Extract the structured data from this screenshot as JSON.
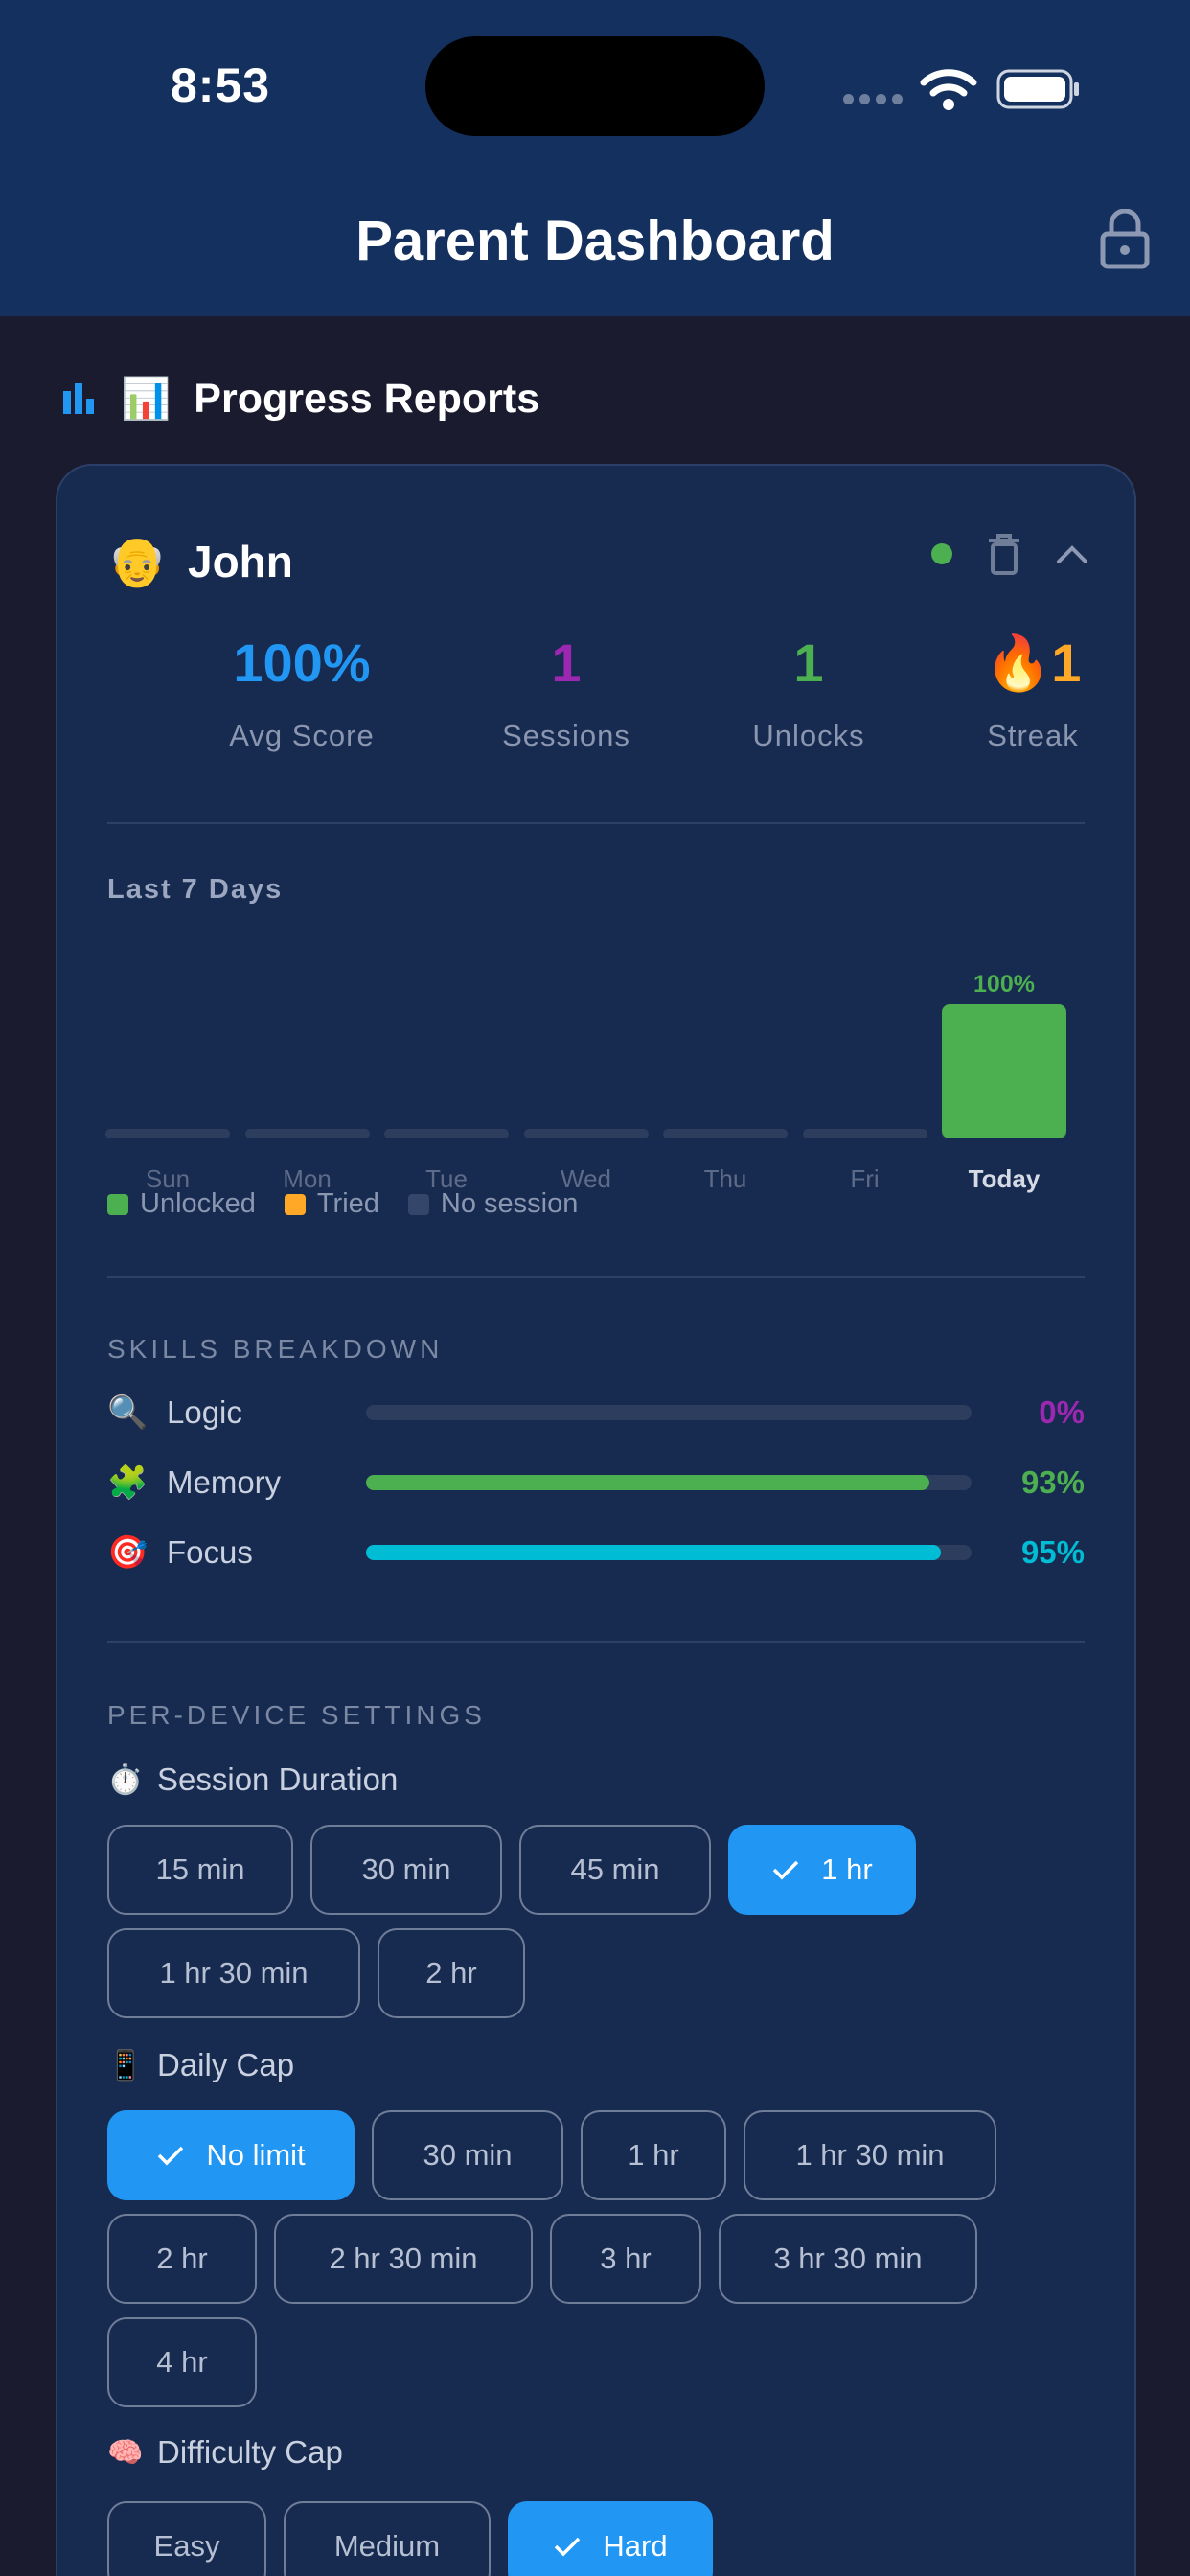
{
  "status_bar": {
    "time": "8:53"
  },
  "header": {
    "title": "Parent Dashboard"
  },
  "section": {
    "emoji": "📊",
    "title": "Progress Reports"
  },
  "child": {
    "emoji": "👴",
    "name": "John",
    "stats": [
      {
        "value": "100%",
        "label": "Avg Score",
        "color": "#2196f3"
      },
      {
        "value": "1",
        "label": "Sessions",
        "color": "#9c27b0"
      },
      {
        "value": "1",
        "label": "Unlocks",
        "color": "#4caf50"
      },
      {
        "value": "🔥1",
        "label": "Streak",
        "color": "#ffa726"
      }
    ]
  },
  "week": {
    "title": "Last 7 Days",
    "days": [
      {
        "label": "Sun",
        "percent": null
      },
      {
        "label": "Mon",
        "percent": null
      },
      {
        "label": "Tue",
        "percent": null
      },
      {
        "label": "Wed",
        "percent": null
      },
      {
        "label": "Thu",
        "percent": null
      },
      {
        "label": "Fri",
        "percent": null
      },
      {
        "label": "Today",
        "percent": 100,
        "percent_label": "100%"
      }
    ],
    "legend": [
      {
        "label": "Unlocked",
        "color": "#4caf50"
      },
      {
        "label": "Tried",
        "color": "#ffa726"
      },
      {
        "label": "No session",
        "color": "#34466a"
      }
    ]
  },
  "skills": {
    "title": "SKILLS BREAKDOWN",
    "items": [
      {
        "icon": "🔍",
        "name": "Logic",
        "percent": 0,
        "label": "0%",
        "color": "#9c27b0"
      },
      {
        "icon": "🧩",
        "name": "Memory",
        "percent": 93,
        "label": "93%",
        "color": "#4caf50"
      },
      {
        "icon": "🎯",
        "name": "Focus",
        "percent": 95,
        "label": "95%",
        "color": "#00bcd4"
      }
    ]
  },
  "settings": {
    "title": "PER-DEVICE SETTINGS",
    "session_duration": {
      "icon": "⏱️",
      "label": "Session Duration",
      "options": [
        "15 min",
        "30 min",
        "45 min",
        "1 hr",
        "1 hr 30 min",
        "2 hr"
      ],
      "selected": "1 hr"
    },
    "daily_cap": {
      "icon": "📱",
      "label": "Daily Cap",
      "options": [
        "No limit",
        "30 min",
        "1 hr",
        "1 hr 30 min",
        "2 hr",
        "2 hr 30 min",
        "3 hr",
        "3 hr 30 min",
        "4 hr"
      ],
      "selected": "No limit"
    },
    "difficulty_cap": {
      "icon": "🧠",
      "label": "Difficulty Cap",
      "options": [
        "Easy",
        "Medium",
        "Hard"
      ],
      "selected": "Hard"
    }
  }
}
